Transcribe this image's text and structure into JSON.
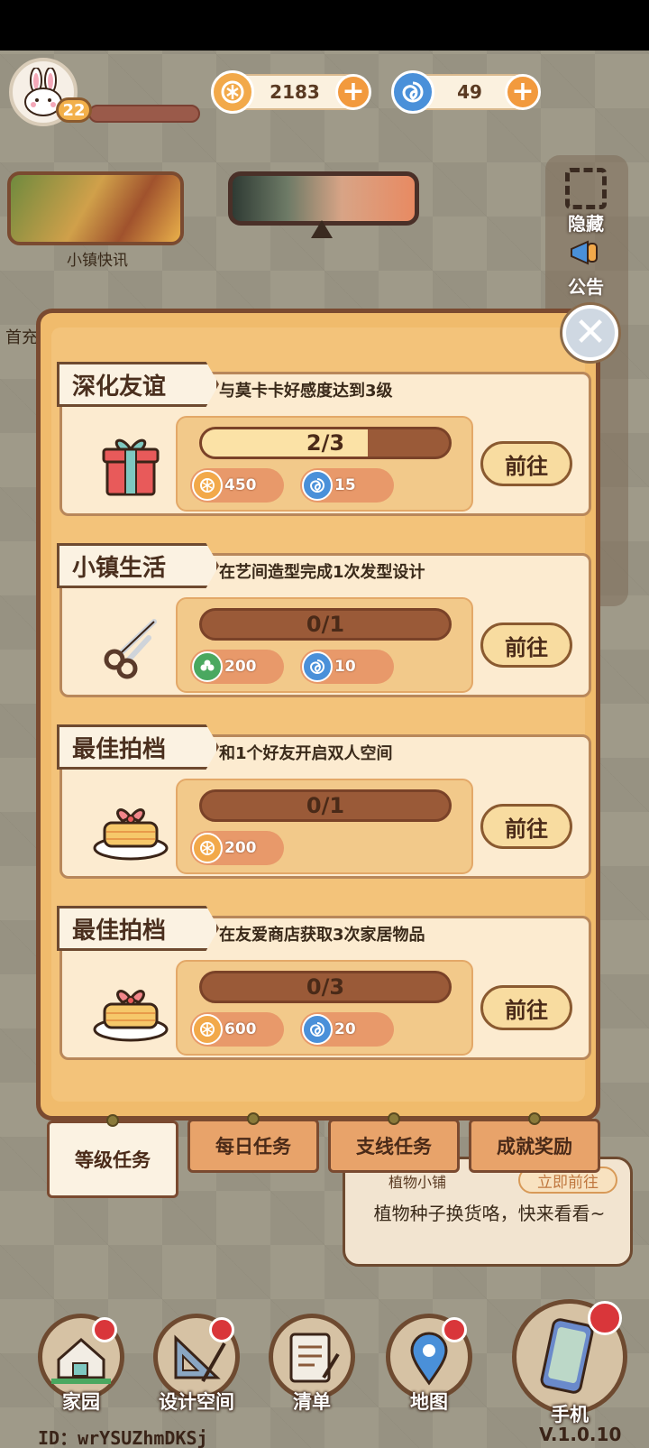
{
  "hud": {
    "level": "22",
    "coins": "2183",
    "gems": "49"
  },
  "left": {
    "news_label": "小镇快讯",
    "first_pay_label": "首充"
  },
  "side": {
    "hide_label": "隐藏",
    "announce_label": "公告"
  },
  "tasks": [
    {
      "tag": "深化友谊",
      "desc": "与莫卡卡好感度达到3级",
      "icon": "gift-icon",
      "progress_text": "2/3",
      "progress": 0.67,
      "rewards": [
        {
          "icon": "coin-icon",
          "value": "450"
        },
        {
          "icon": "swirl-gem-icon",
          "value": "15"
        }
      ],
      "go_label": "前往"
    },
    {
      "tag": "小镇生活",
      "desc": "在艺间造型完成1次发型设计",
      "icon": "scissors-icon",
      "progress_text": "0/1",
      "progress": 0,
      "rewards": [
        {
          "icon": "clover-icon",
          "value": "200"
        },
        {
          "icon": "swirl-gem-icon",
          "value": "10"
        }
      ],
      "go_label": "前往"
    },
    {
      "tag": "最佳拍档",
      "desc": "和1个好友开启双人空间",
      "icon": "cake-icon",
      "progress_text": "0/1",
      "progress": 0,
      "rewards": [
        {
          "icon": "coin-icon",
          "value": "200"
        }
      ],
      "go_label": "前往"
    },
    {
      "tag": "最佳拍档",
      "desc": "在友爱商店获取3次家居物品",
      "icon": "cake-icon",
      "progress_text": "0/3",
      "progress": 0,
      "rewards": [
        {
          "icon": "coin-icon",
          "value": "600"
        },
        {
          "icon": "swirl-gem-icon",
          "value": "20"
        }
      ],
      "go_label": "前往"
    }
  ],
  "tabs": [
    {
      "label": "等级任务",
      "active": true
    },
    {
      "label": "每日任务",
      "active": false
    },
    {
      "label": "支线任务",
      "active": false
    },
    {
      "label": "成就奖励",
      "active": false
    }
  ],
  "notice": {
    "title": "植物小铺",
    "go_label": "立即前往",
    "text": "植物种子换货咯，快来看看~"
  },
  "dock": [
    {
      "label": "家园",
      "has_dot": true
    },
    {
      "label": "设计空间",
      "has_dot": true
    },
    {
      "label": "清单",
      "has_dot": false
    },
    {
      "label": "地图",
      "has_dot": true
    }
  ],
  "phone_label": "手机",
  "footer": {
    "id": "ID：wrYSUZhmDKSj",
    "version": "V.1.0.10"
  },
  "colors": {
    "coin": "#f2a94a",
    "gem": "#4a90d9",
    "clover": "#4aa860",
    "accent": "#f29a3e",
    "red_dot": "#d9363a"
  }
}
